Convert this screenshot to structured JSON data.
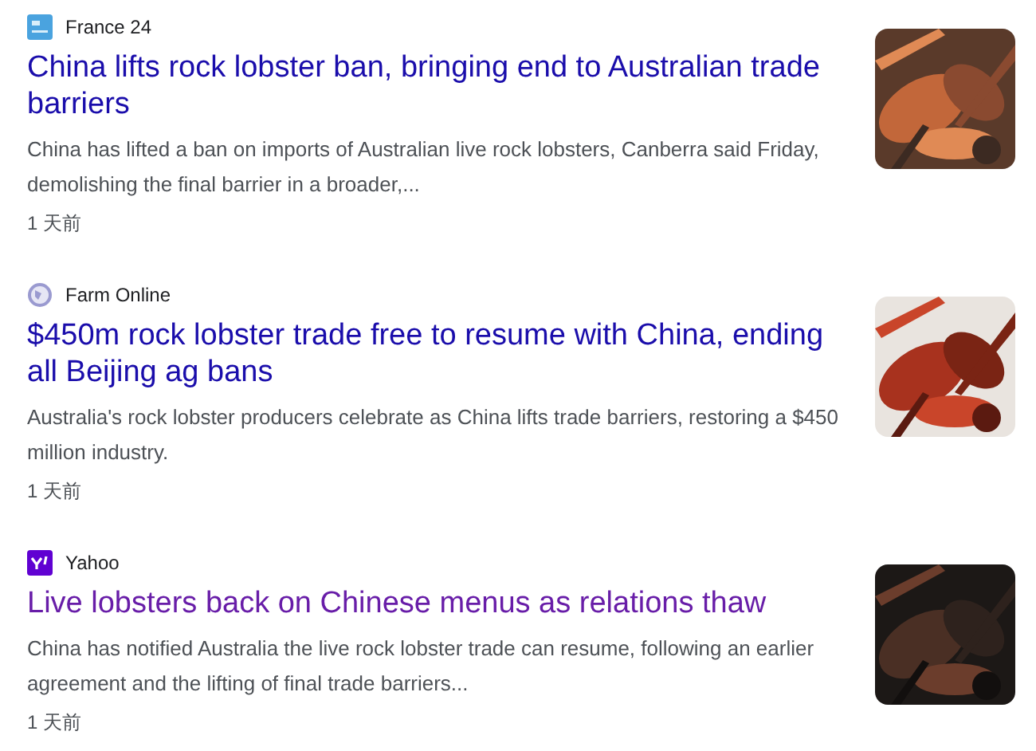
{
  "results": [
    {
      "source": {
        "name": "France 24"
      },
      "title": "China lifts rock lobster ban, bringing end to Australian trade barriers",
      "visited": false,
      "snippet": "China has lifted a ban on imports of Australian live rock lobsters, Canberra said Friday, demolishing the final barrier in a broader,...",
      "time": "1 天前"
    },
    {
      "source": {
        "name": "Farm Online"
      },
      "title": "$450m rock lobster trade free to resume with China, ending all Beijing ag bans",
      "visited": false,
      "snippet": "Australia's rock lobster producers celebrate as China lifts trade barriers, restoring a $450 million industry.",
      "time": "1 天前"
    },
    {
      "source": {
        "name": "Yahoo"
      },
      "title": "Live lobsters back on Chinese menus as relations thaw",
      "visited": true,
      "snippet": "China has notified Australia the live rock lobster trade can resume, following an earlier agreement and the lifting of final trade barriers...",
      "time": "1 天前"
    }
  ]
}
